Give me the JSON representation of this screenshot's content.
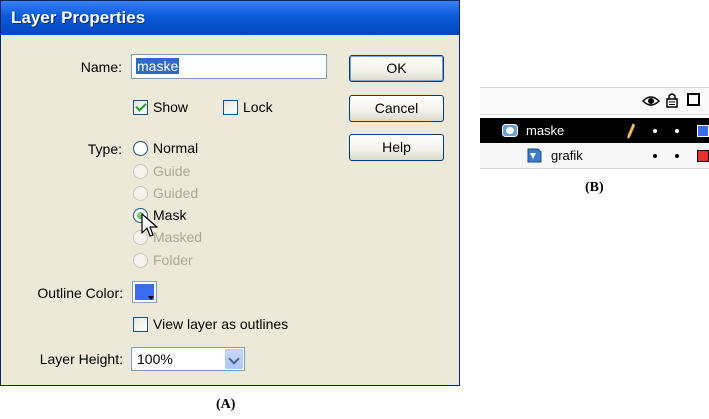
{
  "dialog": {
    "title": "Layer Properties",
    "name_label": "Name:",
    "name_value": "maske",
    "show_label": "Show",
    "show_checked": true,
    "lock_label": "Lock",
    "lock_checked": false,
    "type_label": "Type:",
    "type_options": [
      {
        "label": "Normal",
        "enabled": true,
        "selected": false
      },
      {
        "label": "Guide",
        "enabled": false,
        "selected": false
      },
      {
        "label": "Guided",
        "enabled": false,
        "selected": false
      },
      {
        "label": "Mask",
        "enabled": true,
        "selected": true
      },
      {
        "label": "Masked",
        "enabled": false,
        "selected": false
      },
      {
        "label": "Folder",
        "enabled": false,
        "selected": false
      }
    ],
    "outline_color_label": "Outline Color:",
    "outline_color": "#3b6cf0",
    "view_outlines_label": "View layer as outlines",
    "view_outlines_checked": false,
    "layer_height_label": "Layer Height:",
    "layer_height_value": "100%",
    "buttons": {
      "ok": "OK",
      "cancel": "Cancel",
      "help": "Help"
    }
  },
  "captions": {
    "a": "(A)",
    "b": "(B)"
  },
  "timeline": {
    "header_icons": [
      "eye-icon",
      "lock-icon",
      "outline-square-icon"
    ],
    "layers": [
      {
        "name": "maske",
        "selected": true,
        "icon": "mask-layer-icon",
        "pencil": true,
        "color": "#3b6cf0"
      },
      {
        "name": "grafik",
        "selected": false,
        "icon": "masked-layer-icon",
        "pencil": false,
        "color": "#e8302c"
      }
    ]
  }
}
